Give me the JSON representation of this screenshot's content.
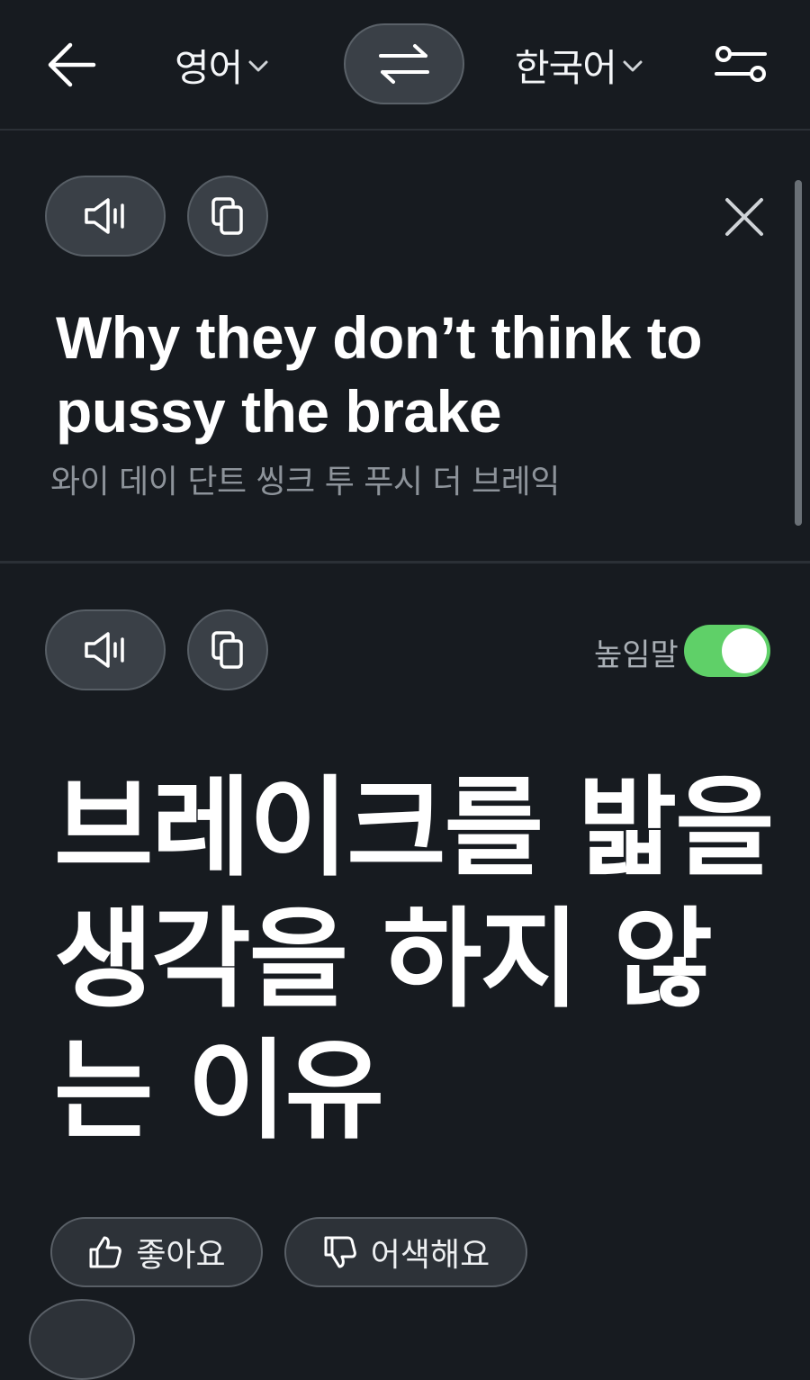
{
  "header": {
    "source_language": "영어",
    "target_language": "한국어"
  },
  "source": {
    "text_line1": "Why they don’t think to",
    "text_line2": "pussy the brake",
    "pronunciation": "와이 데이 단트 씽크 투 푸시 더 브레익"
  },
  "result": {
    "honorific_label": "높임말",
    "honorific_on": true,
    "text_line1": "브레이크를 밟을",
    "text_line2": "생각을 하지 않",
    "text_line3": "는 이유"
  },
  "feedback": {
    "like_label": "좋아요",
    "awkward_label": "어색해요"
  },
  "icons": {
    "back": "arrow-left-icon",
    "swap": "swap-arrows-icon",
    "settings": "sliders-icon",
    "speaker": "speaker-icon",
    "copy": "copy-icon",
    "close": "close-icon",
    "thumbs_up": "thumbs-up-icon",
    "thumbs_down": "thumbs-down-icon"
  },
  "colors": {
    "background": "#171b20",
    "toggle_on": "#5fd068",
    "secondary_text": "#8d939a"
  }
}
